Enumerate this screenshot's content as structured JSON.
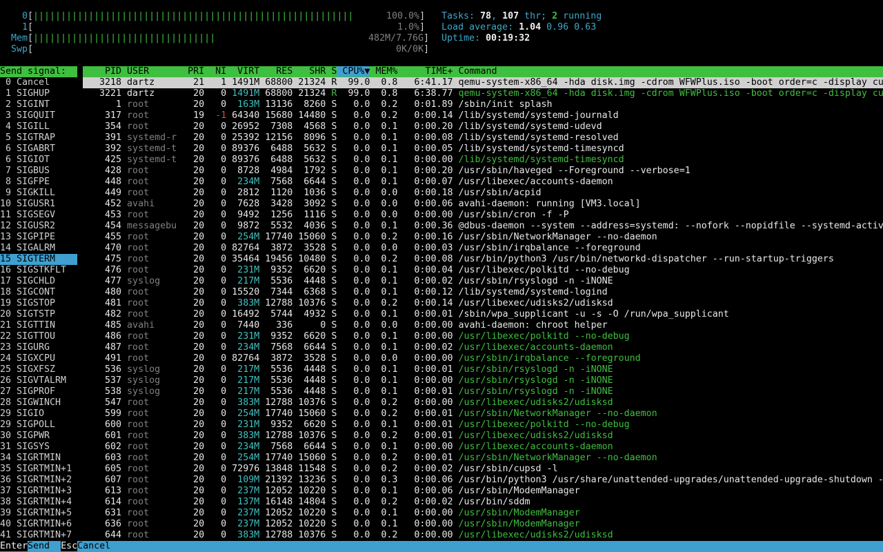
{
  "meters": {
    "cpu0": {
      "label": "0",
      "bar": "||||||||||||||||||||||||||||||||||||||||||||||||||||||||||",
      "value": "100.0%"
    },
    "cpu1": {
      "label": "1",
      "bar": "",
      "value": "1.0%"
    },
    "mem": {
      "label": "Mem",
      "bar": "|||||||||||||||||||||||||||||||||",
      "value": "482M/7.76G"
    },
    "swp": {
      "label": "Swp",
      "bar": "",
      "value": "0K/0K"
    }
  },
  "stats": {
    "tasks_label": "Tasks: ",
    "tasks": "78",
    "sep1": ", ",
    "thr": "107",
    "thr_label": " thr; ",
    "running": "2",
    "running_label": " running",
    "load_label": "Load average: ",
    "load1": "1.04",
    "load5": "0.96",
    "load15": "0.63",
    "uptime_label": "Uptime: ",
    "uptime": "00:19:32"
  },
  "signal_panel": {
    "header": "Send signal:",
    "selected_index": 15,
    "signals": [
      "0 Cancel",
      "1 SIGHUP",
      "2 SIGINT",
      "3 SIGQUIT",
      "4 SIGILL",
      "5 SIGTRAP",
      "6 SIGABRT",
      "6 SIGIOT",
      "7 SIGBUS",
      "8 SIGFPE",
      "9 SIGKILL",
      "10 SIGUSR1",
      "11 SIGSEGV",
      "12 SIGUSR2",
      "13 SIGPIPE",
      "14 SIGALRM",
      "15 SIGTERM",
      "16 SIGSTKFLT",
      "17 SIGCHLD",
      "18 SIGCONT",
      "19 SIGSTOP",
      "20 SIGTSTP",
      "21 SIGTTIN",
      "22 SIGTTOU",
      "23 SIGURG",
      "24 SIGXCPU",
      "25 SIGXFSZ",
      "26 SIGVTALRM",
      "27 SIGPROF",
      "28 SIGWINCH",
      "29 SIGIO",
      "29 SIGPOLL",
      "30 SIGPWR",
      "31 SIGSYS",
      "34 SIGRTMIN",
      "35 SIGRTMIN+1",
      "36 SIGRTMIN+2",
      "37 SIGRTMIN+3",
      "38 SIGRTMIN+4",
      "39 SIGRTMIN+5",
      "40 SIGRTMIN+6",
      "41 SIGRTMIN+7"
    ]
  },
  "process_table": {
    "headers": {
      "pid": "PID",
      "user": "USER",
      "pri": "PRI",
      "ni": "NI",
      "virt": "VIRT",
      "res": "RES",
      "shr": "SHR",
      "s": "S",
      "cpu": "CPU%▼",
      "mem": "MEM%",
      "time": "TIME+",
      "command": "Command"
    },
    "rows": [
      [
        "3218",
        "dartz",
        "21",
        "1",
        "1491M",
        "68800",
        "21324",
        "R",
        "99.0",
        "0.8",
        "6:41.17",
        "qemu-system-x86_64 -hda disk.img -cdrom WFWPlus.iso -boot order=c -display curses"
      ],
      [
        "3221",
        "dartz",
        "20",
        "0",
        "1491M",
        "68800",
        "21324",
        "R",
        "99.0",
        "0.8",
        "6:38.77",
        "qemu-system-x86_64 -hda disk.img -cdrom WFWPlus.iso -boot order=c -display curses"
      ],
      [
        "1",
        "root",
        "20",
        "0",
        "163M",
        "13136",
        "8260",
        "S",
        "0.0",
        "0.2",
        "0:01.89",
        "/sbin/init splash"
      ],
      [
        "317",
        "root",
        "19",
        "-1",
        "64340",
        "15680",
        "14480",
        "S",
        "0.0",
        "0.2",
        "0:00.14",
        "/lib/systemd/systemd-journald"
      ],
      [
        "354",
        "root",
        "20",
        "0",
        "26952",
        "7308",
        "4568",
        "S",
        "0.0",
        "0.1",
        "0:00.20",
        "/lib/systemd/systemd-udevd"
      ],
      [
        "391",
        "systemd-r",
        "20",
        "0",
        "25392",
        "12156",
        "8096",
        "S",
        "0.0",
        "0.1",
        "0:00.08",
        "/lib/systemd/systemd-resolved"
      ],
      [
        "392",
        "systemd-t",
        "20",
        "0",
        "89376",
        "6488",
        "5632",
        "S",
        "0.0",
        "0.1",
        "0:00.05",
        "/lib/systemd/systemd-timesyncd"
      ],
      [
        "425",
        "systemd-t",
        "20",
        "0",
        "89376",
        "6488",
        "5632",
        "S",
        "0.0",
        "0.1",
        "0:00.00",
        "/lib/systemd/systemd-timesyncd"
      ],
      [
        "428",
        "root",
        "20",
        "0",
        "8728",
        "4984",
        "1792",
        "S",
        "0.0",
        "0.1",
        "0:00.20",
        "/usr/sbin/haveged --Foreground --verbose=1"
      ],
      [
        "448",
        "root",
        "20",
        "0",
        "234M",
        "7568",
        "6644",
        "S",
        "0.0",
        "0.1",
        "0:00.07",
        "/usr/libexec/accounts-daemon"
      ],
      [
        "449",
        "root",
        "20",
        "0",
        "2812",
        "1120",
        "1036",
        "S",
        "0.0",
        "0.0",
        "0:00.18",
        "/usr/sbin/acpid"
      ],
      [
        "452",
        "avahi",
        "20",
        "0",
        "7628",
        "3428",
        "3092",
        "S",
        "0.0",
        "0.0",
        "0:00.06",
        "avahi-daemon: running [VM3.local]"
      ],
      [
        "453",
        "root",
        "20",
        "0",
        "9492",
        "1256",
        "1116",
        "S",
        "0.0",
        "0.0",
        "0:00.00",
        "/usr/sbin/cron -f -P"
      ],
      [
        "454",
        "messagebu",
        "20",
        "0",
        "9872",
        "5532",
        "4036",
        "S",
        "0.0",
        "0.1",
        "0:00.36",
        "@dbus-daemon --system --address=systemd: --nofork --nopidfile --systemd-activation"
      ],
      [
        "455",
        "root",
        "20",
        "0",
        "254M",
        "17740",
        "15060",
        "S",
        "0.0",
        "0.2",
        "0:00.16",
        "/usr/sbin/NetworkManager --no-daemon"
      ],
      [
        "470",
        "root",
        "20",
        "0",
        "82764",
        "3872",
        "3528",
        "S",
        "0.0",
        "0.0",
        "0:00.03",
        "/usr/sbin/irqbalance --foreground"
      ],
      [
        "475",
        "root",
        "20",
        "0",
        "35464",
        "19456",
        "10480",
        "S",
        "0.0",
        "0.2",
        "0:00.08",
        "/usr/bin/python3 /usr/bin/networkd-dispatcher --run-startup-triggers"
      ],
      [
        "476",
        "root",
        "20",
        "0",
        "231M",
        "9352",
        "6620",
        "S",
        "0.0",
        "0.1",
        "0:00.04",
        "/usr/libexec/polkitd --no-debug"
      ],
      [
        "477",
        "syslog",
        "20",
        "0",
        "217M",
        "5536",
        "4448",
        "S",
        "0.0",
        "0.1",
        "0:00.02",
        "/usr/sbin/rsyslogd -n -iNONE"
      ],
      [
        "480",
        "root",
        "20",
        "0",
        "15520",
        "7344",
        "6368",
        "S",
        "0.0",
        "0.1",
        "0:00.12",
        "/lib/systemd/systemd-logind"
      ],
      [
        "481",
        "root",
        "20",
        "0",
        "383M",
        "12788",
        "10376",
        "S",
        "0.0",
        "0.2",
        "0:00.14",
        "/usr/libexec/udisks2/udisksd"
      ],
      [
        "482",
        "root",
        "20",
        "0",
        "16492",
        "5744",
        "4932",
        "S",
        "0.0",
        "0.1",
        "0:00.01",
        "/sbin/wpa_supplicant -u -s -O /run/wpa_supplicant"
      ],
      [
        "485",
        "avahi",
        "20",
        "0",
        "7440",
        "336",
        "0",
        "S",
        "0.0",
        "0.0",
        "0:00.00",
        "avahi-daemon: chroot helper"
      ],
      [
        "486",
        "root",
        "20",
        "0",
        "231M",
        "9352",
        "6620",
        "S",
        "0.0",
        "0.1",
        "0:00.00",
        "/usr/libexec/polkitd --no-debug"
      ],
      [
        "487",
        "root",
        "20",
        "0",
        "234M",
        "7568",
        "6644",
        "S",
        "0.0",
        "0.1",
        "0:00.02",
        "/usr/libexec/accounts-daemon"
      ],
      [
        "491",
        "root",
        "20",
        "0",
        "82764",
        "3872",
        "3528",
        "S",
        "0.0",
        "0.0",
        "0:00.00",
        "/usr/sbin/irqbalance --foreground"
      ],
      [
        "536",
        "syslog",
        "20",
        "0",
        "217M",
        "5536",
        "4448",
        "S",
        "0.0",
        "0.1",
        "0:00.01",
        "/usr/sbin/rsyslogd -n -iNONE"
      ],
      [
        "537",
        "syslog",
        "20",
        "0",
        "217M",
        "5536",
        "4448",
        "S",
        "0.0",
        "0.1",
        "0:00.00",
        "/usr/sbin/rsyslogd -n -iNONE"
      ],
      [
        "538",
        "syslog",
        "20",
        "0",
        "217M",
        "5536",
        "4448",
        "S",
        "0.0",
        "0.1",
        "0:00.01",
        "/usr/sbin/rsyslogd -n -iNONE"
      ],
      [
        "547",
        "root",
        "20",
        "0",
        "383M",
        "12788",
        "10376",
        "S",
        "0.0",
        "0.2",
        "0:00.00",
        "/usr/libexec/udisks2/udisksd"
      ],
      [
        "599",
        "root",
        "20",
        "0",
        "254M",
        "17740",
        "15060",
        "S",
        "0.0",
        "0.2",
        "0:00.01",
        "/usr/sbin/NetworkManager --no-daemon"
      ],
      [
        "600",
        "root",
        "20",
        "0",
        "231M",
        "9352",
        "6620",
        "S",
        "0.0",
        "0.1",
        "0:00.01",
        "/usr/libexec/polkitd --no-debug"
      ],
      [
        "601",
        "root",
        "20",
        "0",
        "383M",
        "12788",
        "10376",
        "S",
        "0.0",
        "0.2",
        "0:00.01",
        "/usr/libexec/udisks2/udisksd"
      ],
      [
        "602",
        "root",
        "20",
        "0",
        "234M",
        "7568",
        "6644",
        "S",
        "0.0",
        "0.1",
        "0:00.00",
        "/usr/libexec/accounts-daemon"
      ],
      [
        "603",
        "root",
        "20",
        "0",
        "254M",
        "17740",
        "15060",
        "S",
        "0.0",
        "0.2",
        "0:00.01",
        "/usr/sbin/NetworkManager --no-daemon"
      ],
      [
        "605",
        "root",
        "20",
        "0",
        "72976",
        "13848",
        "11548",
        "S",
        "0.0",
        "0.2",
        "0:00.02",
        "/usr/sbin/cupsd -l"
      ],
      [
        "607",
        "root",
        "20",
        "0",
        "109M",
        "21392",
        "13236",
        "S",
        "0.0",
        "0.3",
        "0:00.06",
        "/usr/bin/python3 /usr/share/unattended-upgrades/unattended-upgrade-shutdown --wait"
      ],
      [
        "613",
        "root",
        "20",
        "0",
        "237M",
        "12052",
        "10220",
        "S",
        "0.0",
        "0.1",
        "0:00.06",
        "/usr/sbin/ModemManager"
      ],
      [
        "614",
        "root",
        "20",
        "0",
        "137M",
        "16148",
        "14804",
        "S",
        "0.0",
        "0.2",
        "0:00.02",
        "/usr/bin/sddm"
      ],
      [
        "631",
        "root",
        "20",
        "0",
        "237M",
        "12052",
        "10220",
        "S",
        "0.0",
        "0.1",
        "0:00.00",
        "/usr/sbin/ModemManager"
      ],
      [
        "636",
        "root",
        "20",
        "0",
        "237M",
        "12052",
        "10220",
        "S",
        "0.0",
        "0.1",
        "0:00.00",
        "/usr/sbin/ModemManager"
      ],
      [
        "644",
        "root",
        "20",
        "0",
        "383M",
        "12788",
        "10376",
        "S",
        "0.0",
        "0.2",
        "0:00.00",
        "/usr/libexec/udisks2/udisksd"
      ]
    ],
    "thread_pids": [
      "3221",
      "425",
      "486",
      "487",
      "491",
      "536",
      "537",
      "538",
      "547",
      "599",
      "600",
      "601",
      "602",
      "603",
      "631",
      "636",
      "644"
    ]
  },
  "footer": {
    "key1": "Enter",
    "action1": "Send  ",
    "key2": "Esc",
    "action2": "Cancel"
  },
  "colors": {
    "header_bg": "#3fbf3f",
    "selected_bg": "#3fa0d0",
    "highlight_bg": "#d0d0d0",
    "thread_fg": "#3fbf3f",
    "label_fg": "#3fa7c9"
  }
}
